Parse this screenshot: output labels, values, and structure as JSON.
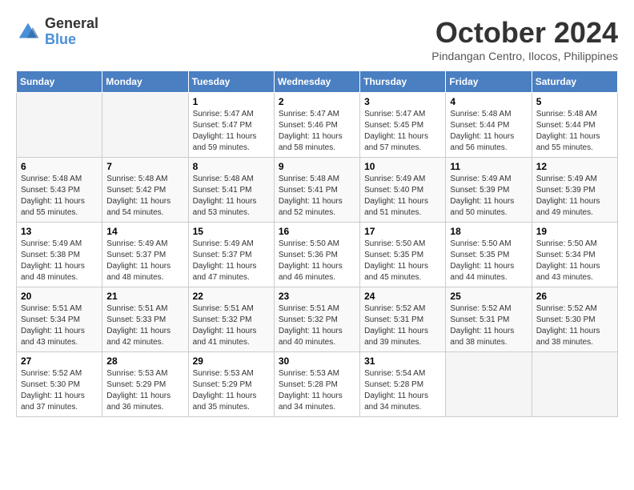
{
  "logo": {
    "general": "General",
    "blue": "Blue"
  },
  "header": {
    "month_year": "October 2024",
    "location": "Pindangan Centro, Ilocos, Philippines"
  },
  "days_of_week": [
    "Sunday",
    "Monday",
    "Tuesday",
    "Wednesday",
    "Thursday",
    "Friday",
    "Saturday"
  ],
  "weeks": [
    [
      {
        "day": "",
        "sunrise": "",
        "sunset": "",
        "daylight": ""
      },
      {
        "day": "",
        "sunrise": "",
        "sunset": "",
        "daylight": ""
      },
      {
        "day": "1",
        "sunrise": "Sunrise: 5:47 AM",
        "sunset": "Sunset: 5:47 PM",
        "daylight": "Daylight: 11 hours and 59 minutes."
      },
      {
        "day": "2",
        "sunrise": "Sunrise: 5:47 AM",
        "sunset": "Sunset: 5:46 PM",
        "daylight": "Daylight: 11 hours and 58 minutes."
      },
      {
        "day": "3",
        "sunrise": "Sunrise: 5:47 AM",
        "sunset": "Sunset: 5:45 PM",
        "daylight": "Daylight: 11 hours and 57 minutes."
      },
      {
        "day": "4",
        "sunrise": "Sunrise: 5:48 AM",
        "sunset": "Sunset: 5:44 PM",
        "daylight": "Daylight: 11 hours and 56 minutes."
      },
      {
        "day": "5",
        "sunrise": "Sunrise: 5:48 AM",
        "sunset": "Sunset: 5:44 PM",
        "daylight": "Daylight: 11 hours and 55 minutes."
      }
    ],
    [
      {
        "day": "6",
        "sunrise": "Sunrise: 5:48 AM",
        "sunset": "Sunset: 5:43 PM",
        "daylight": "Daylight: 11 hours and 55 minutes."
      },
      {
        "day": "7",
        "sunrise": "Sunrise: 5:48 AM",
        "sunset": "Sunset: 5:42 PM",
        "daylight": "Daylight: 11 hours and 54 minutes."
      },
      {
        "day": "8",
        "sunrise": "Sunrise: 5:48 AM",
        "sunset": "Sunset: 5:41 PM",
        "daylight": "Daylight: 11 hours and 53 minutes."
      },
      {
        "day": "9",
        "sunrise": "Sunrise: 5:48 AM",
        "sunset": "Sunset: 5:41 PM",
        "daylight": "Daylight: 11 hours and 52 minutes."
      },
      {
        "day": "10",
        "sunrise": "Sunrise: 5:49 AM",
        "sunset": "Sunset: 5:40 PM",
        "daylight": "Daylight: 11 hours and 51 minutes."
      },
      {
        "day": "11",
        "sunrise": "Sunrise: 5:49 AM",
        "sunset": "Sunset: 5:39 PM",
        "daylight": "Daylight: 11 hours and 50 minutes."
      },
      {
        "day": "12",
        "sunrise": "Sunrise: 5:49 AM",
        "sunset": "Sunset: 5:39 PM",
        "daylight": "Daylight: 11 hours and 49 minutes."
      }
    ],
    [
      {
        "day": "13",
        "sunrise": "Sunrise: 5:49 AM",
        "sunset": "Sunset: 5:38 PM",
        "daylight": "Daylight: 11 hours and 48 minutes."
      },
      {
        "day": "14",
        "sunrise": "Sunrise: 5:49 AM",
        "sunset": "Sunset: 5:37 PM",
        "daylight": "Daylight: 11 hours and 48 minutes."
      },
      {
        "day": "15",
        "sunrise": "Sunrise: 5:49 AM",
        "sunset": "Sunset: 5:37 PM",
        "daylight": "Daylight: 11 hours and 47 minutes."
      },
      {
        "day": "16",
        "sunrise": "Sunrise: 5:50 AM",
        "sunset": "Sunset: 5:36 PM",
        "daylight": "Daylight: 11 hours and 46 minutes."
      },
      {
        "day": "17",
        "sunrise": "Sunrise: 5:50 AM",
        "sunset": "Sunset: 5:35 PM",
        "daylight": "Daylight: 11 hours and 45 minutes."
      },
      {
        "day": "18",
        "sunrise": "Sunrise: 5:50 AM",
        "sunset": "Sunset: 5:35 PM",
        "daylight": "Daylight: 11 hours and 44 minutes."
      },
      {
        "day": "19",
        "sunrise": "Sunrise: 5:50 AM",
        "sunset": "Sunset: 5:34 PM",
        "daylight": "Daylight: 11 hours and 43 minutes."
      }
    ],
    [
      {
        "day": "20",
        "sunrise": "Sunrise: 5:51 AM",
        "sunset": "Sunset: 5:34 PM",
        "daylight": "Daylight: 11 hours and 43 minutes."
      },
      {
        "day": "21",
        "sunrise": "Sunrise: 5:51 AM",
        "sunset": "Sunset: 5:33 PM",
        "daylight": "Daylight: 11 hours and 42 minutes."
      },
      {
        "day": "22",
        "sunrise": "Sunrise: 5:51 AM",
        "sunset": "Sunset: 5:32 PM",
        "daylight": "Daylight: 11 hours and 41 minutes."
      },
      {
        "day": "23",
        "sunrise": "Sunrise: 5:51 AM",
        "sunset": "Sunset: 5:32 PM",
        "daylight": "Daylight: 11 hours and 40 minutes."
      },
      {
        "day": "24",
        "sunrise": "Sunrise: 5:52 AM",
        "sunset": "Sunset: 5:31 PM",
        "daylight": "Daylight: 11 hours and 39 minutes."
      },
      {
        "day": "25",
        "sunrise": "Sunrise: 5:52 AM",
        "sunset": "Sunset: 5:31 PM",
        "daylight": "Daylight: 11 hours and 38 minutes."
      },
      {
        "day": "26",
        "sunrise": "Sunrise: 5:52 AM",
        "sunset": "Sunset: 5:30 PM",
        "daylight": "Daylight: 11 hours and 38 minutes."
      }
    ],
    [
      {
        "day": "27",
        "sunrise": "Sunrise: 5:52 AM",
        "sunset": "Sunset: 5:30 PM",
        "daylight": "Daylight: 11 hours and 37 minutes."
      },
      {
        "day": "28",
        "sunrise": "Sunrise: 5:53 AM",
        "sunset": "Sunset: 5:29 PM",
        "daylight": "Daylight: 11 hours and 36 minutes."
      },
      {
        "day": "29",
        "sunrise": "Sunrise: 5:53 AM",
        "sunset": "Sunset: 5:29 PM",
        "daylight": "Daylight: 11 hours and 35 minutes."
      },
      {
        "day": "30",
        "sunrise": "Sunrise: 5:53 AM",
        "sunset": "Sunset: 5:28 PM",
        "daylight": "Daylight: 11 hours and 34 minutes."
      },
      {
        "day": "31",
        "sunrise": "Sunrise: 5:54 AM",
        "sunset": "Sunset: 5:28 PM",
        "daylight": "Daylight: 11 hours and 34 minutes."
      },
      {
        "day": "",
        "sunrise": "",
        "sunset": "",
        "daylight": ""
      },
      {
        "day": "",
        "sunrise": "",
        "sunset": "",
        "daylight": ""
      }
    ]
  ]
}
